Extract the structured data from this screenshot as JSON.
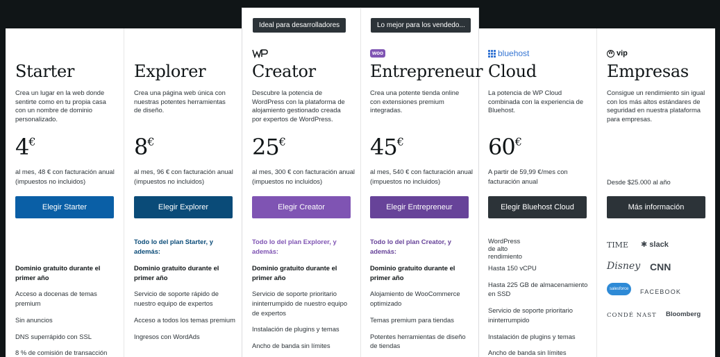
{
  "plans": [
    {
      "name": "Starter",
      "description": "Crea un lugar en la web donde sentirte como en tu propia casa con un nombre de dominio personalizado.",
      "price": "4",
      "currency": "€",
      "billing": "al mes, 48 € con facturación anual (impuestos no incluidos)",
      "cta": "Elegir Starter",
      "cta_color": "#0a5fa6",
      "features": [
        "Dominio gratuito durante el primer año",
        "Acceso a docenas de temas premium",
        "Sin anuncios",
        "DNS superrápido con SSL",
        "8 % de comisión de transacción"
      ]
    },
    {
      "name": "Explorer",
      "description": "Crea una página web única con nuestras potentes herramientas de diseño.",
      "price": "8",
      "currency": "€",
      "billing": "al mes, 96 € con facturación anual (impuestos no incluidos)",
      "cta": "Elegir Explorer",
      "cta_color": "#0a4b78",
      "includes": "Todo lo del plan Starter, y además:",
      "includes_color": "#0a4b78",
      "features": [
        "Dominio gratuito durante el primer año",
        "Servicio de soporte rápido de nuestro equipo de expertos",
        "Acceso a todos los temas premium",
        "Ingresos con WordAds"
      ]
    },
    {
      "tag": "Ideal para desarrolladores",
      "logo": "WP",
      "name": "Creator",
      "description": "Descubre la potencia de WordPress con la plataforma de alojamiento gestionado creada por expertos de WordPress.",
      "price": "25",
      "currency": "€",
      "billing": "al mes, 300 € con facturación anual (impuestos no incluidos)",
      "cta": "Elegir Creator",
      "cta_color": "#7f54b3",
      "includes": "Todo lo del plan Explorer, y además:",
      "includes_color": "#7f54b3",
      "features": [
        "Dominio gratuito durante el primer año",
        "Servicio de soporte prioritario ininterrumpido de nuestro equipo de expertos",
        "Instalación de plugins y temas",
        "Ancho de banda sin límites"
      ]
    },
    {
      "tag": "Lo mejor para los vendedo...",
      "logo": "woo",
      "name": "Entrepreneur",
      "description": "Crea una potente tienda online con extensiones premium integradas.",
      "price": "45",
      "currency": "€",
      "billing": "al mes, 540 € con facturación anual (impuestos no incluidos)",
      "cta": "Elegir Entrepreneur",
      "cta_color": "#674399",
      "includes": "Todo lo del plan Creator, y además:",
      "includes_color": "#674399",
      "features": [
        "Dominio gratuito durante el primer año",
        "Alojamiento de WooCommerce optimizado",
        "Temas premium para tiendas",
        "Potentes herramientas de diseño de tiendas"
      ]
    },
    {
      "logo": "bluehost",
      "name": "Cloud",
      "description": "La potencia de WP Cloud combinada con la experiencia de Bluehost.",
      "price": "60",
      "currency": "€",
      "billing": "A partir de 59,99 €/mes con facturación anual",
      "cta": "Elegir Bluehost Cloud",
      "cta_color": "#2c3338",
      "highlight": "WordPress de alto rendimiento",
      "features": [
        "Hasta 150 vCPU",
        "Hasta 225 GB de almacenamiento en SSD",
        "Servicio de soporte prioritario ininterrumpido",
        "Instalación de plugins y temas",
        "Ancho de banda sin límites"
      ]
    },
    {
      "logo": "vip",
      "name": "Empresas",
      "description": "Consigue un rendimiento sin igual con los más altos estándares de seguridad en nuestra plataforma para empresas.",
      "billing": "Desde $25.000 al año",
      "cta": "Más información",
      "cta_color": "#2c3338",
      "brands": [
        "TIME",
        "slack",
        "Disney",
        "CNN",
        "salesforce",
        "FACEBOOK",
        "CONDÉ NAST",
        "Bloomberg"
      ]
    }
  ]
}
